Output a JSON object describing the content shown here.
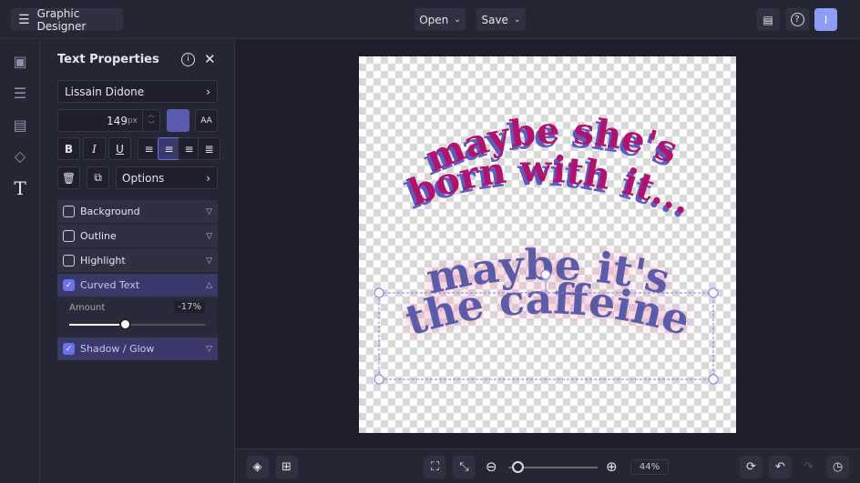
{
  "topbar": {
    "app_title": "Graphic Designer",
    "open_label": "Open",
    "save_label": "Save",
    "avatar_initial": "I"
  },
  "rail": {
    "items": [
      "image-icon",
      "adjustments-icon",
      "layout-icon",
      "elements-icon",
      "text-icon"
    ]
  },
  "panel": {
    "title": "Text Properties",
    "font": "Lissain Didone",
    "size": "149",
    "size_unit": "px",
    "color": "#5b5cb0",
    "options_label": "Options",
    "sections": [
      {
        "label": "Background",
        "checked": false
      },
      {
        "label": "Outline",
        "checked": false
      },
      {
        "label": "Highlight",
        "checked": false
      },
      {
        "label": "Curved Text",
        "checked": true
      },
      {
        "label": "Shadow / Glow",
        "checked": true
      }
    ],
    "amount_label": "Amount",
    "amount_value": "-17%",
    "amount_fraction": 0.41
  },
  "canvas": {
    "text1_line1": "maybe she's",
    "text1_line2": "born with it...",
    "text2_line1": "maybe it's",
    "text2_line2": "the caffeine"
  },
  "bottombar": {
    "zoom": "44%",
    "zoom_fraction": 0.1
  },
  "colors": {
    "accent": "#6b72e8",
    "magenta": "#b0136e",
    "purple": "#5b5ca8"
  }
}
